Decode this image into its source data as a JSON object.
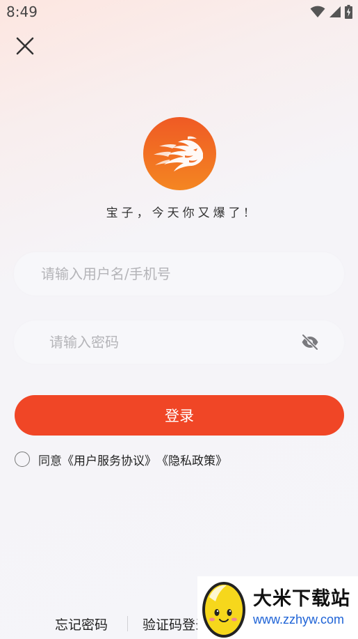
{
  "status_bar": {
    "time": "8:49"
  },
  "header": {
    "close_icon": "close-icon"
  },
  "brand": {
    "logo_icon": "tiger-logo-icon",
    "tagline": "宝子，今天你又爆了!"
  },
  "form": {
    "username_placeholder": "请输入用户名/手机号",
    "username_value": "",
    "password_placeholder": "请输入密码",
    "password_value": "",
    "password_toggle_icon": "eye-off-icon",
    "login_label": "登录"
  },
  "agreement": {
    "prefix": "同意",
    "user_agreement": "《用户服务协议》",
    "privacy_policy": "《隐私政策》",
    "checked": false
  },
  "footer": {
    "forgot_password": "忘记密码",
    "code_login": "验证码登录"
  },
  "watermark": {
    "title": "大米下载站",
    "url": "www.zzhyw.com"
  },
  "colors": {
    "accent": "#f04626",
    "logo_top": "#ef5a24",
    "logo_bottom": "#f48622",
    "watermark_url": "#1e63d6"
  }
}
